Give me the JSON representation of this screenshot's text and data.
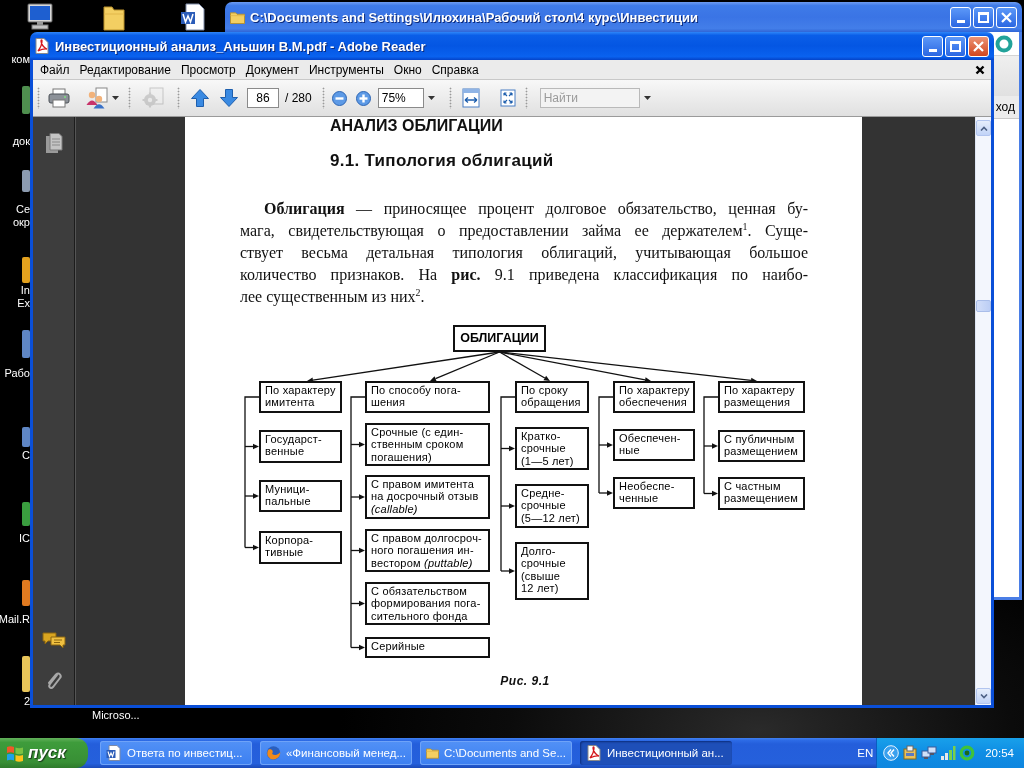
{
  "desktop": {
    "icons": [
      {
        "label": "ком"
      },
      {
        "label": "док"
      },
      {
        "label": "Се\nокр"
      },
      {
        "label": "In\nEx"
      },
      {
        "label": "Рабо"
      },
      {
        "label": "С"
      },
      {
        "label": "IC"
      },
      {
        "label": "Mail.R"
      },
      {
        "label": "2"
      },
      {
        "label": "Microso..."
      }
    ]
  },
  "explorer_window": {
    "title": "C:\\Documents and Settings\\Илюхина\\Рабочий стол\\4 курс\\Инвестиции",
    "active": false,
    "partial_text": "ход"
  },
  "reader_window": {
    "title": "Инвестиционный анализ_Аньшин В.М.pdf - Adobe Reader",
    "active": true,
    "menu": [
      "Файл",
      "Редактирование",
      "Просмотр",
      "Документ",
      "Инструменты",
      "Окно",
      "Справка"
    ],
    "toolbar": {
      "tools": [
        {
          "kind": "print",
          "disabled": false
        },
        {
          "kind": "collaborate",
          "disabled": false
        },
        {
          "kind": "review",
          "disabled": true
        },
        {
          "kind": "previous_page",
          "disabled": false
        },
        {
          "kind": "next_page",
          "disabled": false
        },
        {
          "kind": "zoom_out",
          "disabled": false
        },
        {
          "kind": "zoom_in",
          "disabled": false
        },
        {
          "kind": "fit_width",
          "disabled": false
        },
        {
          "kind": "fit_page",
          "disabled": false
        }
      ],
      "page": "86",
      "page_total": "/ 280",
      "zoom": "75%",
      "search_placeholder": "Найти"
    },
    "document": {
      "running_head": "АНАЛИЗ ОБЛИГАЦИИ",
      "section_title": "9.1. Типология облигаций",
      "paragraph_lines": [
        "**Облигация** — приносящее процент долговое обязательство, ценная бу-",
        "мага, свидетельствующая о предоставлении займа ее держателем$^{1}$. Суще-",
        "ствует весьма детальная типология облигаций, учитывающая большое",
        "количество признаков. На **рис.** 9.1 приведена классификация по наибо-",
        "лее существенным из них$^{2}$."
      ],
      "figure": {
        "root": {
          "label": "ОБЛИГАЦИИ",
          "children": [
            {
              "label": "По характеру\nимитента",
              "children": [
                {
                  "label": "Государст-\nвенные"
                },
                {
                  "label": "Муници-\nпальные"
                },
                {
                  "label": "Корпора-\nтивные"
                }
              ]
            },
            {
              "label": "По способу пога-\nшения",
              "children": [
                {
                  "label": "Срочные (с един-\nственным сроком\nпогашения)"
                },
                {
                  "label": "С правом имитента\nна досрочный отзыв\n*(callable)*"
                },
                {
                  "label": "С правом долгосроч-\nного погашения ин-\nвестором *(puttable)*"
                },
                {
                  "label": "С обязательством\nформирования пога-\nсительного фонда"
                },
                {
                  "label": "Серийные"
                }
              ]
            },
            {
              "label": "По сроку\nобращения",
              "children": [
                {
                  "label": "Кратко-\nсрочные\n(1—5 лет)"
                },
                {
                  "label": "Средне-\nсрочные\n(5—12 лет)"
                },
                {
                  "label": "Долго-\nсрочные\n(свыше\n12 лет)"
                }
              ]
            },
            {
              "label": "По характеру\nобеспечения",
              "children": [
                {
                  "label": "Обеспечен-\nные"
                },
                {
                  "label": "Необеспе-\nченные"
                }
              ]
            },
            {
              "label": "По характеру\nразмещения",
              "children": [
                {
                  "label": "С публичным\nразмещением"
                },
                {
                  "label": "С частным\nразмещением"
                }
              ]
            }
          ]
        },
        "caption": "Рис. 9.1"
      }
    }
  },
  "taskbar": {
    "start": "пуск",
    "tasks": [
      {
        "kind": "document",
        "label": "Ответа по инвестиц...",
        "selected": false
      },
      {
        "kind": "browser",
        "label": "«Финансовый менед...",
        "selected": false
      },
      {
        "kind": "folder",
        "label": "C:\\Documents and Se...",
        "selected": false
      },
      {
        "kind": "pdf",
        "label": "Инвестиционный ан...",
        "selected": true
      }
    ],
    "language": "EN",
    "clock": "20:54"
  }
}
